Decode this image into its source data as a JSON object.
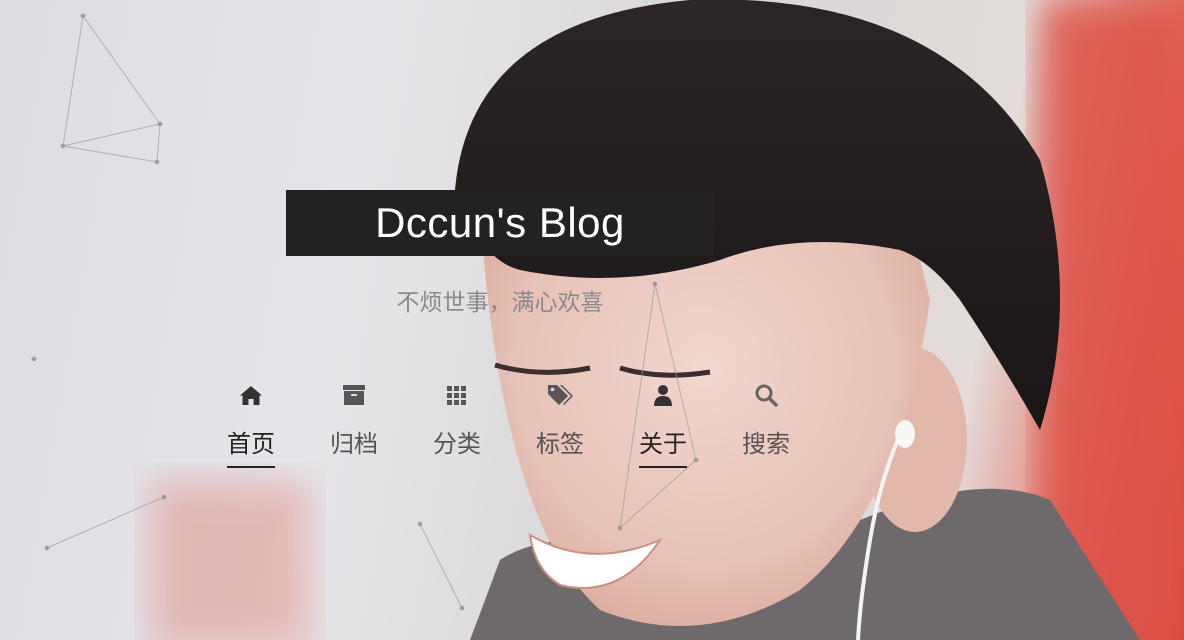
{
  "site": {
    "title": "Dccun's Blog",
    "subtitle": "不烦世事，满心欢喜"
  },
  "nav": {
    "items": [
      {
        "label": "首页",
        "icon": "home-icon",
        "active": true
      },
      {
        "label": "归档",
        "icon": "archive-icon",
        "active": false
      },
      {
        "label": "分类",
        "icon": "grid-icon",
        "active": false
      },
      {
        "label": "标签",
        "icon": "tags-icon",
        "active": false
      },
      {
        "label": "关于",
        "icon": "user-icon",
        "active": true
      },
      {
        "label": "搜索",
        "icon": "search-icon",
        "active": false
      }
    ]
  },
  "colors": {
    "brand_bg": "#222222",
    "brand_text": "#ffffff",
    "subtitle": "#8a8a8a",
    "nav_text": "#555555",
    "nav_active": "#222222"
  }
}
